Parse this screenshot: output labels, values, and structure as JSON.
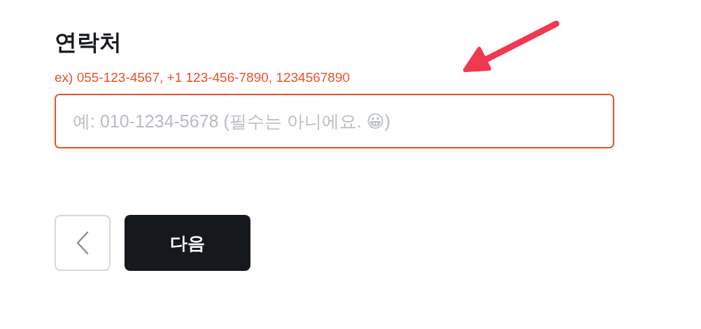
{
  "field": {
    "label": "연락처",
    "hint": "ex) 055-123-4567, +1 123-456-7890, 1234567890",
    "placeholder": "예: 010-1234-5678 (필수는 아니에요. 😀)"
  },
  "buttons": {
    "next": "다음"
  }
}
